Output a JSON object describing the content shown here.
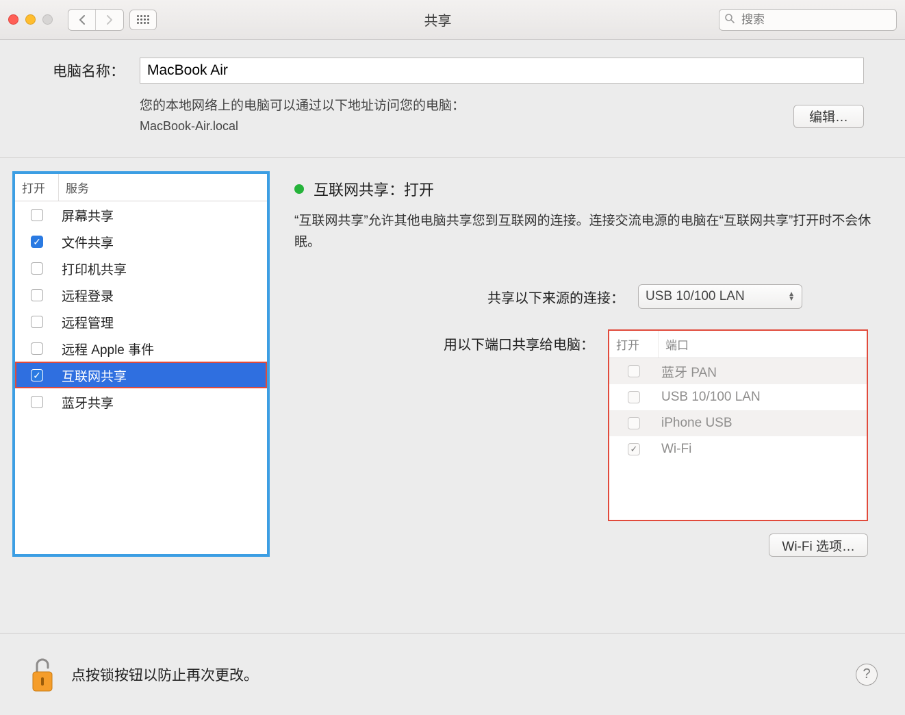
{
  "toolbar": {
    "title": "共享",
    "search_placeholder": "搜索"
  },
  "top": {
    "name_label": "电脑名称：",
    "name_value": "MacBook Air",
    "desc_line1": "您的本地网络上的电脑可以通过以下地址访问您的电脑：",
    "desc_line2": "MacBook-Air.local",
    "edit_label": "编辑…"
  },
  "services": {
    "header_on": "打开",
    "header_svc": "服务",
    "items": [
      {
        "label": "屏幕共享",
        "checked": false,
        "selected": false
      },
      {
        "label": "文件共享",
        "checked": true,
        "selected": false
      },
      {
        "label": "打印机共享",
        "checked": false,
        "selected": false
      },
      {
        "label": "远程登录",
        "checked": false,
        "selected": false
      },
      {
        "label": "远程管理",
        "checked": false,
        "selected": false
      },
      {
        "label": "远程 Apple 事件",
        "checked": false,
        "selected": false
      },
      {
        "label": "互联网共享",
        "checked": true,
        "selected": true
      },
      {
        "label": "蓝牙共享",
        "checked": false,
        "selected": false
      }
    ]
  },
  "detail": {
    "status_title": "互联网共享：打开",
    "status_desc": "“互联网共享”允许其他电脑共享您到互联网的连接。连接交流电源的电脑在“互联网共享”打开时不会休眠。",
    "share_from_label": "共享以下来源的连接：",
    "share_from_value": "USB 10/100 LAN",
    "share_to_label": "用以下端口共享给电脑：",
    "ports_header_on": "打开",
    "ports_header_name": "端口",
    "ports": [
      {
        "label": "蓝牙 PAN",
        "checked": false
      },
      {
        "label": "USB 10/100 LAN",
        "checked": false
      },
      {
        "label": "iPhone USB",
        "checked": false
      },
      {
        "label": "Wi-Fi",
        "checked": true
      }
    ],
    "wifi_options_label": "Wi-Fi 选项…"
  },
  "footer": {
    "lock_text": "点按锁按钮以防止再次更改。",
    "help_label": "?"
  }
}
